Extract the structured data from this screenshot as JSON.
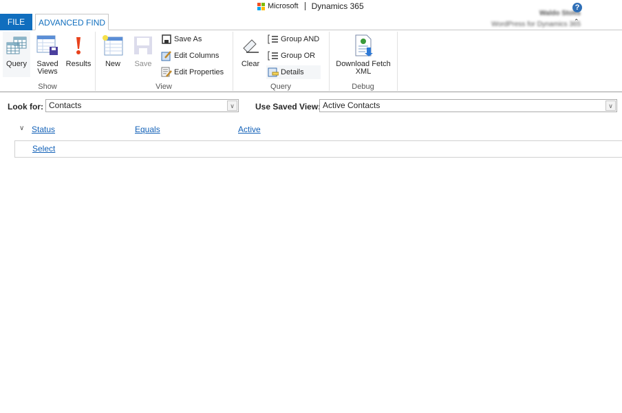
{
  "header": {
    "brand": "Microsoft",
    "product": "Dynamics 365",
    "user_name": "Waldo Stolts",
    "org_name": "WordPress for Dynamics 365",
    "help_icon": "question-circle-icon",
    "collapse_icon": "chevron-up-icon"
  },
  "tabs": [
    {
      "label": "FILE",
      "active": false
    },
    {
      "label": "ADVANCED FIND",
      "active": true
    }
  ],
  "colors": {
    "accent": "#106ebe",
    "link": "#1160b7"
  },
  "ribbon": {
    "groups": [
      {
        "label": "Show",
        "buttons": [
          {
            "label1": "Query",
            "icon": "query-grid-icon"
          },
          {
            "label1": "Saved",
            "label2": "Views",
            "icon": "saved-views-icon"
          },
          {
            "label1": "Results",
            "icon": "exclamation-icon"
          }
        ]
      },
      {
        "label": "View",
        "buttons": [
          {
            "label1": "New",
            "icon": "new-view-icon"
          },
          {
            "label1": "Save",
            "icon": "save-disk-icon",
            "disabled": true
          }
        ],
        "small": [
          {
            "label": "Save As",
            "icon": "save-as-icon"
          },
          {
            "label": "Edit Columns",
            "icon": "edit-columns-icon"
          },
          {
            "label": "Edit Properties",
            "icon": "edit-properties-icon"
          }
        ]
      },
      {
        "label": "Query",
        "buttons": [
          {
            "label1": "Clear",
            "icon": "eraser-icon"
          }
        ],
        "small": [
          {
            "label": "Group AND",
            "icon": "group-and-icon"
          },
          {
            "label": "Group OR",
            "icon": "group-or-icon"
          },
          {
            "label": "Details",
            "icon": "details-icon"
          }
        ]
      },
      {
        "label": "Debug",
        "buttons": [
          {
            "label1": "Download Fetch",
            "label2": "XML",
            "icon": "download-xml-icon"
          }
        ]
      }
    ]
  },
  "form": {
    "look_for_label": "Look for:",
    "look_for_value": "Contacts",
    "saved_view_label": "Use Saved View:",
    "saved_view_value": "Active Contacts"
  },
  "criteria": {
    "field": "Status",
    "operator": "Equals",
    "value": "Active",
    "select_label": "Select"
  }
}
